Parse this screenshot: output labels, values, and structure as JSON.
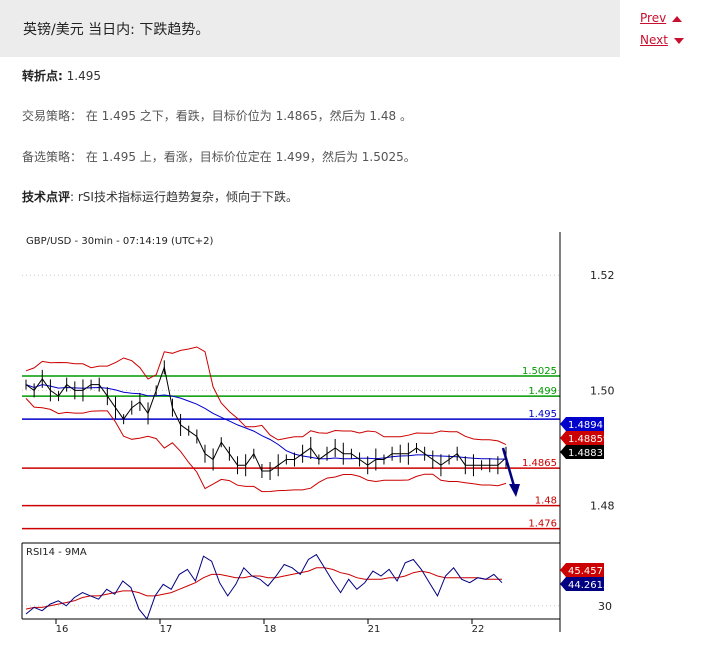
{
  "header": {
    "title": "英镑/美元 当日内: 下跌趋势。"
  },
  "nav": {
    "prev": "Prev",
    "next": "Next"
  },
  "content": {
    "pivot_label": "转折点:",
    "pivot_value": "1.495",
    "strategy": "交易策略： 在 1.495 之下，看跌，目标价位为 1.4865，然后为 1.48 。",
    "alternative": "备选策略： 在 1.495 上，看涨，目标价位定在 1.499，然后为 1.5025。",
    "comment_label": "技术点评",
    "comment_text": ": rSI技术指标运行趋势复杂，倾向于下跌。"
  },
  "colors": {
    "red": "#cc0000",
    "green": "#009900",
    "blue": "#0000cc",
    "navy": "#000080",
    "accent": "#c8102e"
  },
  "chart_data": [
    {
      "type": "line",
      "title": "GBP/USD - 30min - 07:14:19 (UTC+2)",
      "x_labels": [
        "16",
        "17",
        "18",
        "21",
        "22"
      ],
      "ylim": [
        1.4735,
        1.5275
      ],
      "yticks": [
        "1.52",
        "1.50",
        "1.48"
      ],
      "grid": true,
      "series": [
        {
          "name": "",
          "values": [
            1.501,
            1.5,
            1.502,
            1.5,
            1.499,
            1.501,
            1.5,
            1.5,
            1.501,
            1.501,
            1.499,
            1.497,
            1.495,
            1.497,
            1.498,
            1.496,
            1.5,
            1.504,
            1.497,
            1.494,
            1.493,
            1.492,
            1.489,
            1.488,
            1.491,
            1.489,
            1.487,
            1.487,
            1.489,
            1.486,
            1.486,
            1.487,
            1.488,
            1.488,
            1.489,
            1.49,
            1.488,
            1.489,
            1.49,
            1.489,
            1.489,
            1.488,
            1.487,
            1.488,
            1.488,
            1.489,
            1.489,
            1.489,
            1.49,
            1.489,
            1.488,
            1.487,
            1.488,
            1.489,
            1.487,
            1.487,
            1.487,
            1.487,
            1.487,
            1.4883
          ]
        }
      ],
      "levels": [
        {
          "value": 1.5025,
          "label": "1.5025",
          "color": "#009900"
        },
        {
          "value": 1.499,
          "label": "1.499",
          "color": "#009900"
        },
        {
          "value": 1.495,
          "label": "1.495",
          "color": "#0000cc"
        },
        {
          "value": 1.4865,
          "label": "1.4865",
          "color": "#cc0000"
        },
        {
          "value": 1.48,
          "label": "1.48",
          "color": "#cc0000"
        },
        {
          "value": 1.476,
          "label": "1.476",
          "color": "#cc0000"
        }
      ],
      "price_tags": [
        {
          "value": 1.48941,
          "label": "1.48941",
          "color": "#0000cc"
        },
        {
          "value": 1.48859,
          "label": "1.48859",
          "color": "#cc0000"
        },
        {
          "value": 1.4883,
          "label": "1.4883",
          "color": "#000000"
        }
      ]
    },
    {
      "type": "line",
      "title": "RSI14 - 9MA",
      "ylim": [
        22,
        68
      ],
      "yticks": [
        "30"
      ],
      "series": [
        {
          "name": "",
          "values": [
            25,
            29,
            27,
            31,
            33,
            30,
            35,
            38,
            36,
            34,
            40,
            37,
            45,
            41,
            28,
            22,
            36,
            43,
            40,
            49,
            52,
            45,
            60,
            57,
            44,
            36,
            43,
            53,
            48,
            46,
            42,
            48,
            55,
            53,
            49,
            58,
            61,
            53,
            45,
            38,
            46,
            40,
            44,
            51,
            48,
            52,
            45,
            56,
            58,
            52,
            44,
            36,
            48,
            53,
            46,
            44,
            47,
            46,
            49,
            44
          ]
        },
        {
          "name": "",
          "values": [
            28,
            29,
            29,
            30,
            31,
            32,
            33,
            35,
            36,
            36,
            37,
            38,
            39,
            39,
            38,
            36,
            36,
            37,
            38,
            40,
            42,
            44,
            47,
            49,
            49,
            48,
            47,
            47,
            48,
            48,
            47,
            47,
            48,
            49,
            50,
            51,
            53,
            53,
            52,
            50,
            49,
            47,
            46,
            46,
            46,
            47,
            47,
            48,
            50,
            51,
            50,
            48,
            47,
            47,
            47,
            47,
            47,
            46,
            46,
            46
          ]
        }
      ],
      "price_tags": [
        {
          "value": 45.4571,
          "label": "45.4571",
          "color": "#cc0000"
        },
        {
          "value": 44.2613,
          "label": "44.2613",
          "color": "#000080"
        }
      ]
    }
  ]
}
